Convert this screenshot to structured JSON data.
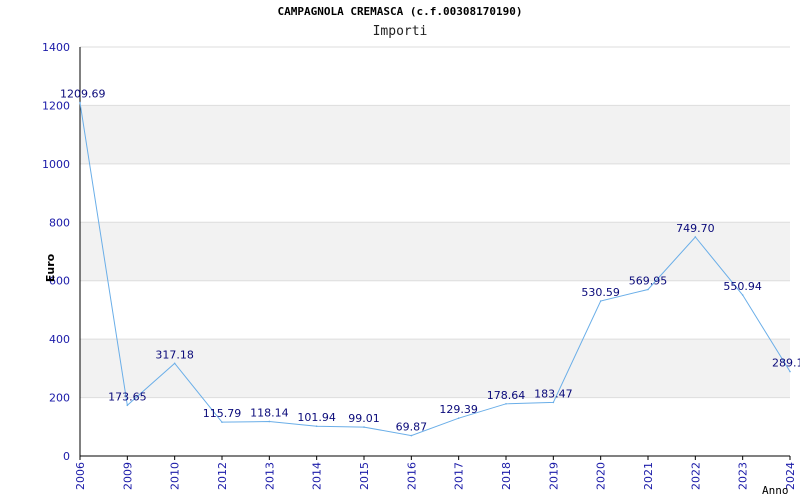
{
  "chart_data": {
    "type": "line",
    "title": "CAMPAGNOLA CREMASCA (c.f.00308170190)",
    "subtitle": "Importi",
    "xlabel": "Anno",
    "ylabel": "Euro",
    "ylim": [
      0,
      1400
    ],
    "yticks": [
      "0",
      "200",
      "400",
      "600",
      "800",
      "1000",
      "1200",
      "1400"
    ],
    "grid": "alternating horizontal bands",
    "categories": [
      "2006",
      "2009",
      "2010",
      "2012",
      "2013",
      "2014",
      "2015",
      "2016",
      "2017",
      "2018",
      "2019",
      "2020",
      "2021",
      "2022",
      "2023",
      "2024"
    ],
    "series": [
      {
        "values": [
          1209.69,
          173.65,
          317.18,
          115.79,
          118.14,
          101.94,
          99.01,
          69.87,
          129.39,
          178.64,
          183.47,
          530.59,
          569.95,
          749.7,
          550.94,
          289.1
        ],
        "labels": [
          "1209.69",
          "173.65",
          "317.18",
          "115.79",
          "118.14",
          "101.94",
          "99.01",
          "69.87",
          "129.39",
          "178.64",
          "183.47",
          "530.59",
          "569.95",
          "749.70",
          "550.94",
          "289.1"
        ],
        "color": "#6aaee8"
      }
    ],
    "colors": {
      "tick": "#1a1aa8",
      "label": "#0a0a7a",
      "band": "#f2f2f2",
      "grid": "#dddddd"
    }
  }
}
